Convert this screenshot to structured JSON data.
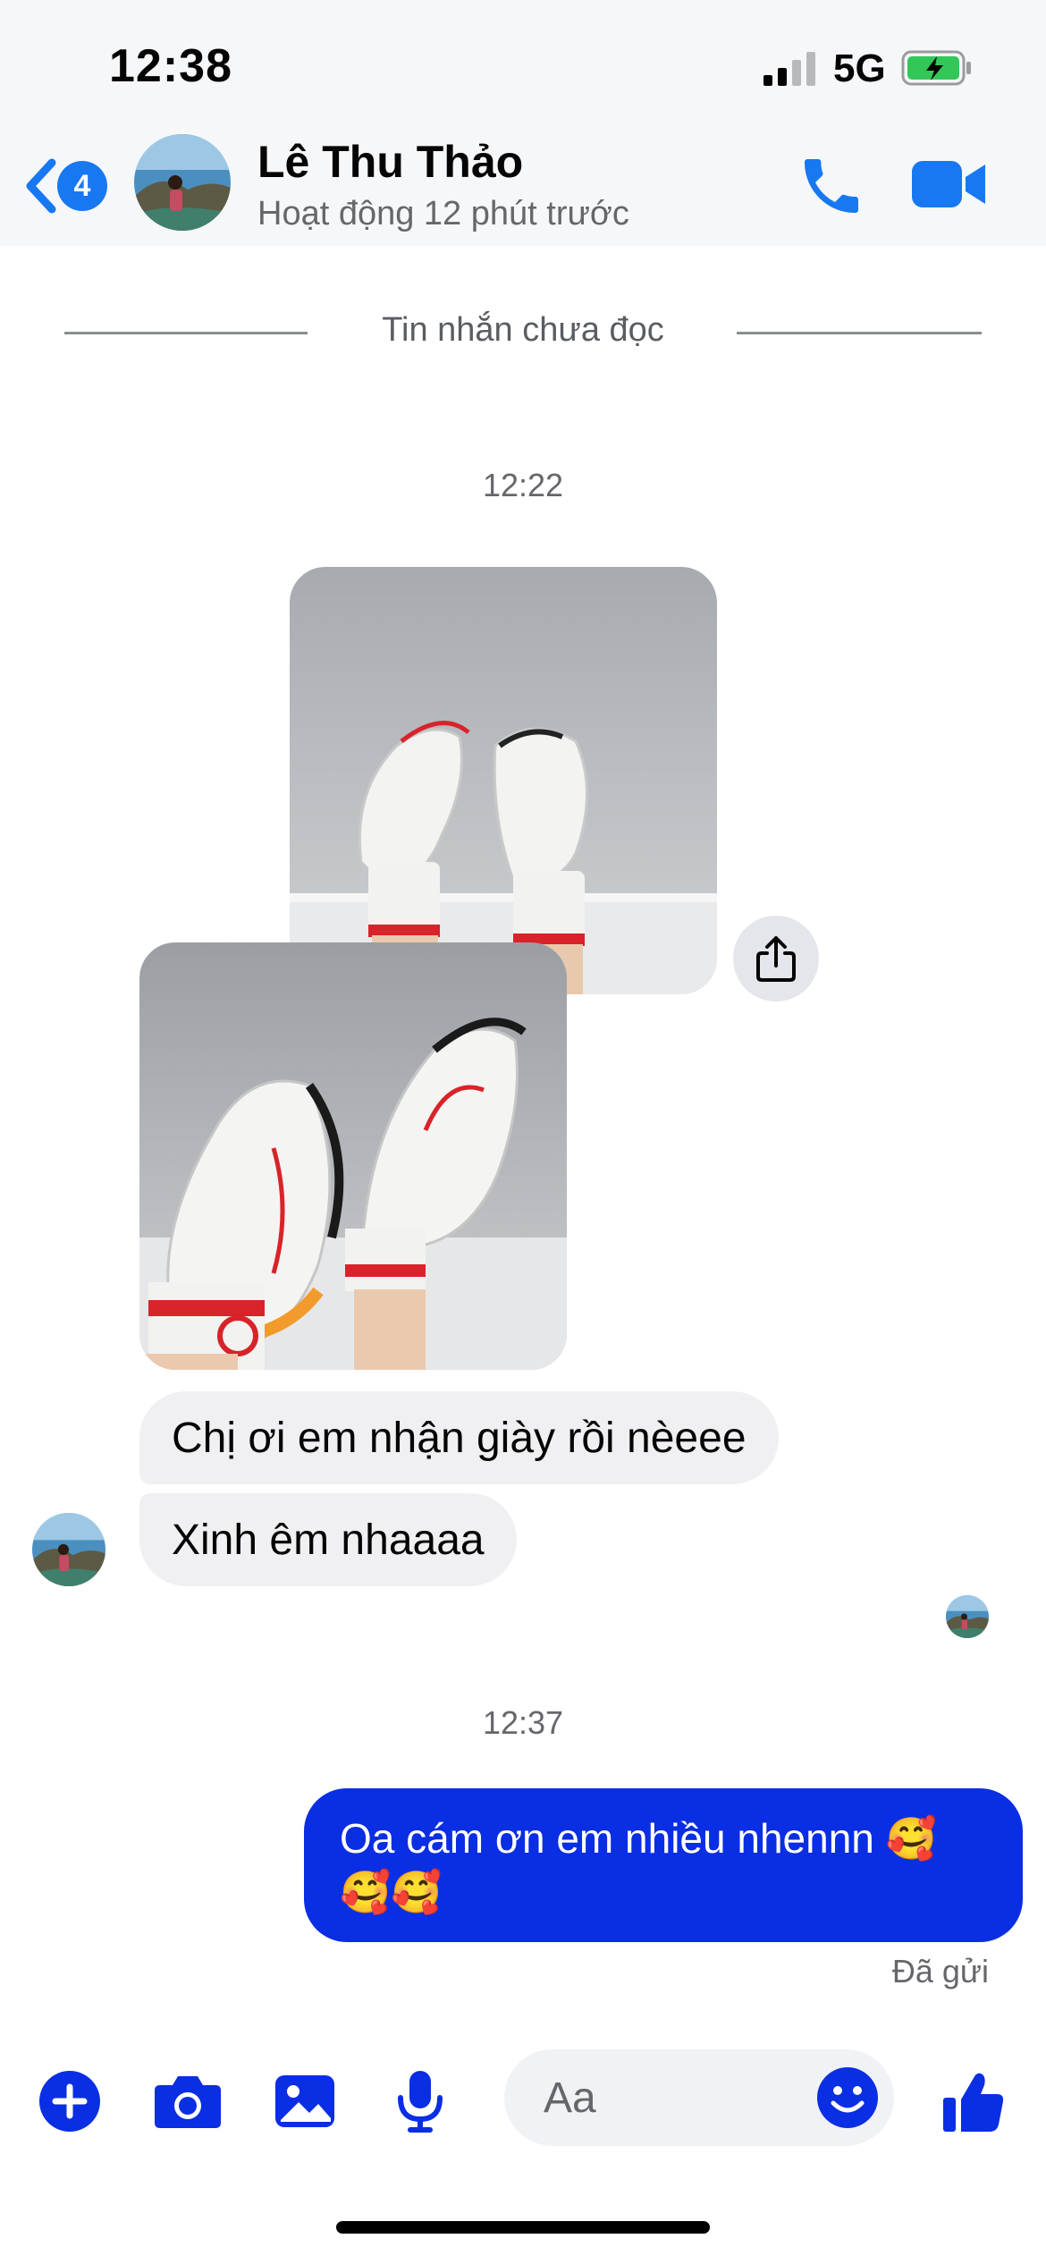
{
  "status_bar": {
    "time": "12:38",
    "network": "5G"
  },
  "header": {
    "unread_count": "4",
    "contact_name": "Lê Thu Thảo",
    "contact_status": "Hoạt động 12 phút trước"
  },
  "divider_label": "Tin nhắn chưa đọc",
  "timestamps": [
    "12:22",
    "12:37"
  ],
  "incoming_messages": [
    "Chị ơi em nhận giày rồi nèeee",
    "Xinh êm nhaaaa"
  ],
  "outgoing_message": {
    "line1": "Oa cám ơn em nhiều nhennn 🥰",
    "line2": "🥰🥰",
    "status": "Đã gửi"
  },
  "composer": {
    "placeholder": "Aa"
  },
  "colors": {
    "accent": "#0a2ee3",
    "incoming_bubble": "#f0f0f2",
    "badge": "#1778f2"
  },
  "icons": [
    "chevron-left-icon",
    "phone-icon",
    "video-camera-icon",
    "share-icon",
    "plus-icon",
    "camera-icon",
    "image-icon",
    "microphone-icon",
    "emoji-icon",
    "thumbs-up-icon"
  ]
}
